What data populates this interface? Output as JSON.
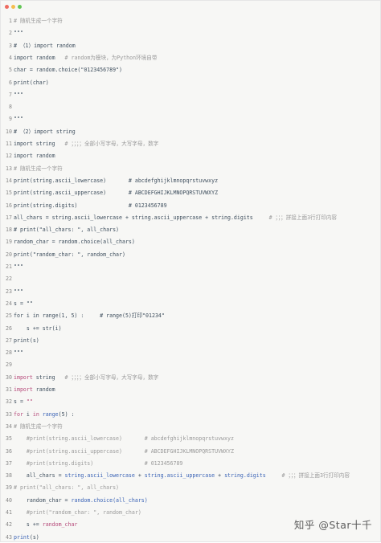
{
  "window": {
    "controls": [
      {
        "name": "close",
        "color": "#ee6a5f"
      },
      {
        "name": "minimize",
        "color": "#f5be4f"
      },
      {
        "name": "maximize",
        "color": "#62c655"
      }
    ]
  },
  "code": {
    "lines": [
      {
        "n": "1",
        "segs": [
          {
            "t": "# 随机生成一个字符",
            "c": "cmt"
          }
        ]
      },
      {
        "n": "2",
        "segs": [
          {
            "t": "\"\"\""
          }
        ]
      },
      {
        "n": "3",
        "segs": [
          {
            "t": "# （1）import random"
          }
        ]
      },
      {
        "n": "4",
        "segs": [
          {
            "t": "import random   "
          },
          {
            "t": "# random为模块，为Python环境自带",
            "c": "cmt"
          }
        ]
      },
      {
        "n": "5",
        "segs": [
          {
            "t": "char = random.choice(\"0123456789\")"
          }
        ]
      },
      {
        "n": "6",
        "segs": [
          {
            "t": "print(char)"
          }
        ]
      },
      {
        "n": "7",
        "segs": [
          {
            "t": "\"\"\""
          }
        ]
      },
      {
        "n": "8",
        "segs": []
      },
      {
        "n": "9",
        "segs": [
          {
            "t": "\"\"\""
          }
        ]
      },
      {
        "n": "10",
        "segs": [
          {
            "t": "# （2）import string"
          }
        ]
      },
      {
        "n": "11",
        "segs": [
          {
            "t": "import string   "
          },
          {
            "t": "# ；；；；全部小写字母，大写字母，数字",
            "c": "cmt"
          }
        ]
      },
      {
        "n": "12",
        "segs": [
          {
            "t": "import random"
          }
        ]
      },
      {
        "n": "13",
        "segs": [
          {
            "t": "# 随机生成一个字符",
            "c": "cmt"
          }
        ]
      },
      {
        "n": "14",
        "segs": [
          {
            "t": "print(string.ascii_lowercase)       # abcdefghijklmnopqrstuvwxyz"
          }
        ]
      },
      {
        "n": "15",
        "segs": [
          {
            "t": "print(string.ascii_uppercase)       # ABCDEFGHIJKLMNOPQRSTUVWXYZ"
          }
        ]
      },
      {
        "n": "16",
        "segs": [
          {
            "t": "print(string.digits)                # 0123456789"
          }
        ]
      },
      {
        "n": "17",
        "segs": [
          {
            "t": "all_chars = string.ascii_lowercase + string.ascii_uppercase + string.digits     "
          },
          {
            "t": "# ；；；拼接上面3行打印内容",
            "c": "cmt"
          }
        ]
      },
      {
        "n": "18",
        "segs": [
          {
            "t": "# print(\"all_chars: \", all_chars)"
          }
        ]
      },
      {
        "n": "19",
        "segs": [
          {
            "t": "random_char = random.choice(all_chars)"
          }
        ]
      },
      {
        "n": "20",
        "segs": [
          {
            "t": "print(\"random_char: \", random_char)"
          }
        ]
      },
      {
        "n": "21",
        "segs": [
          {
            "t": "\"\"\""
          }
        ]
      },
      {
        "n": "22",
        "segs": []
      },
      {
        "n": "23",
        "segs": [
          {
            "t": "\"\"\""
          }
        ]
      },
      {
        "n": "24",
        "segs": [
          {
            "t": "s = \"\""
          }
        ]
      },
      {
        "n": "25",
        "segs": [
          {
            "t": "for i in range(1, 5) :     # range(5)打印\"01234\""
          }
        ]
      },
      {
        "n": "26",
        "segs": [
          {
            "t": "    s += str(i)"
          }
        ]
      },
      {
        "n": "27",
        "segs": [
          {
            "t": "print(s)"
          }
        ]
      },
      {
        "n": "28",
        "segs": [
          {
            "t": "\"\"\""
          }
        ]
      },
      {
        "n": "29",
        "segs": []
      },
      {
        "n": "30",
        "segs": [
          {
            "t": "import",
            "c": "kw"
          },
          {
            "t": " string   "
          },
          {
            "t": "# ；；；；全部小写字母，大写字母，数字",
            "c": "cmt"
          }
        ]
      },
      {
        "n": "31",
        "segs": [
          {
            "t": "import",
            "c": "kw"
          },
          {
            "t": " random"
          }
        ]
      },
      {
        "n": "32",
        "segs": [
          {
            "t": "s = "
          },
          {
            "t": "\"\"",
            "c": "kw"
          }
        ]
      },
      {
        "n": "33",
        "segs": [
          {
            "t": "for",
            "c": "kw"
          },
          {
            "t": " i "
          },
          {
            "t": "in",
            "c": "kw"
          },
          {
            "t": " "
          },
          {
            "t": "range",
            "c": "bl"
          },
          {
            "t": "(5) :"
          }
        ]
      },
      {
        "n": "34",
        "segs": [
          {
            "t": "# 随机生成一个字符",
            "c": "cmt"
          }
        ]
      },
      {
        "n": "35",
        "segs": [
          {
            "t": "    #print(string.ascii_lowercase)       # abcdefghijklmnopqrstuvwxyz",
            "c": "cmt"
          }
        ]
      },
      {
        "n": "36",
        "segs": [
          {
            "t": "    #print(string.ascii_uppercase)       # ABCDEFGHIJKLMNOPQRSTUVWXYZ",
            "c": "cmt"
          }
        ]
      },
      {
        "n": "37",
        "segs": [
          {
            "t": "    #print(string.digits)                # 0123456789",
            "c": "cmt"
          }
        ]
      },
      {
        "n": "38",
        "segs": [
          {
            "t": "    all_chars = "
          },
          {
            "t": "string.ascii_lowercase",
            "c": "bl"
          },
          {
            "t": " + "
          },
          {
            "t": "string.ascii_uppercase",
            "c": "bl"
          },
          {
            "t": " + "
          },
          {
            "t": "string.digits",
            "c": "bl"
          },
          {
            "t": "     "
          },
          {
            "t": "# ；；；拼接上面3行打印内容",
            "c": "cmt"
          }
        ]
      },
      {
        "n": "39",
        "segs": [
          {
            "t": "# print(\"all_chars: \", all_chars)",
            "c": "cmt"
          }
        ]
      },
      {
        "n": "40",
        "segs": [
          {
            "t": "    random_char = "
          },
          {
            "t": "random.choice(all_chars)",
            "c": "bl"
          }
        ]
      },
      {
        "n": "41",
        "segs": [
          {
            "t": "    #print(\"random_char: \", random_char)",
            "c": "cmt"
          }
        ]
      },
      {
        "n": "42",
        "segs": [
          {
            "t": "    s += "
          },
          {
            "t": "random_char",
            "c": "kw"
          }
        ]
      },
      {
        "n": "43",
        "segs": [
          {
            "t": "print",
            "c": "bl"
          },
          {
            "t": "(s)"
          }
        ]
      }
    ]
  },
  "watermark": "知乎 @Star十千"
}
